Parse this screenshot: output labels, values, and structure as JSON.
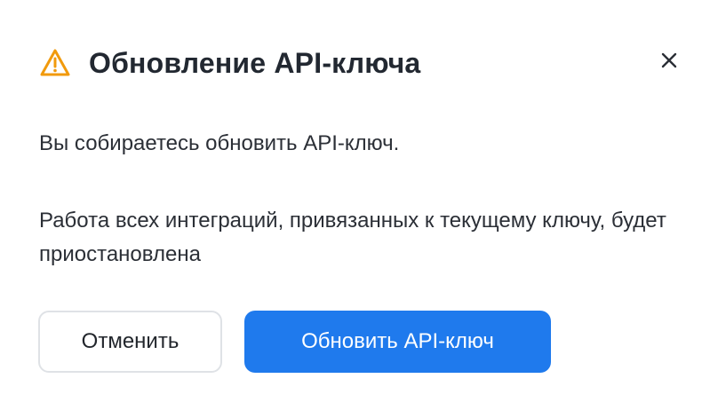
{
  "dialog": {
    "title": "Обновление API-ключа",
    "icon": "warning-triangle-icon",
    "close_icon": "close-icon",
    "message_primary": "Вы собираетесь обновить API-ключ.",
    "message_secondary": "Работа всех интеграций, привязанных к текущему ключу, будет приостановлена",
    "buttons": {
      "cancel_label": "Отменить",
      "confirm_label": "Обновить API-ключ"
    }
  },
  "colors": {
    "warning": "#f19a0c",
    "primary": "#1f7aed",
    "text": "#2b2f36",
    "border": "#dfe2e6"
  }
}
